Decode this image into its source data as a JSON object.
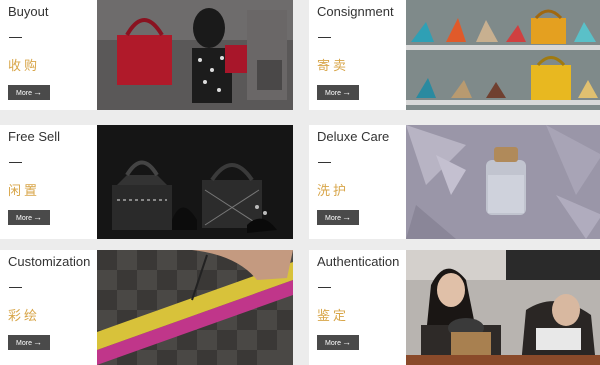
{
  "cards": [
    {
      "title": "Buyout",
      "cn": "收购",
      "more_label": "More",
      "arrow": "→"
    },
    {
      "title": "Consignment",
      "cn": "寄卖",
      "more_label": "More",
      "arrow": "→"
    },
    {
      "title": "Free Sell",
      "cn": "闲置",
      "more_label": "More",
      "arrow": "→"
    },
    {
      "title": "Deluxe Care",
      "cn": "洗护",
      "more_label": "More",
      "arrow": "→"
    },
    {
      "title": "Customization",
      "cn": "彩绘",
      "more_label": "More",
      "arrow": "→"
    },
    {
      "title": "Authentication",
      "cn": "鉴定",
      "more_label": "More",
      "arrow": "→"
    }
  ],
  "colors": {
    "accent": "#d8a64a",
    "button_bg": "#4a4a4a",
    "panel_bg": "#ffffff",
    "page_bg": "#ececec"
  },
  "icons": {
    "more_arrow": "arrow-right-icon"
  }
}
